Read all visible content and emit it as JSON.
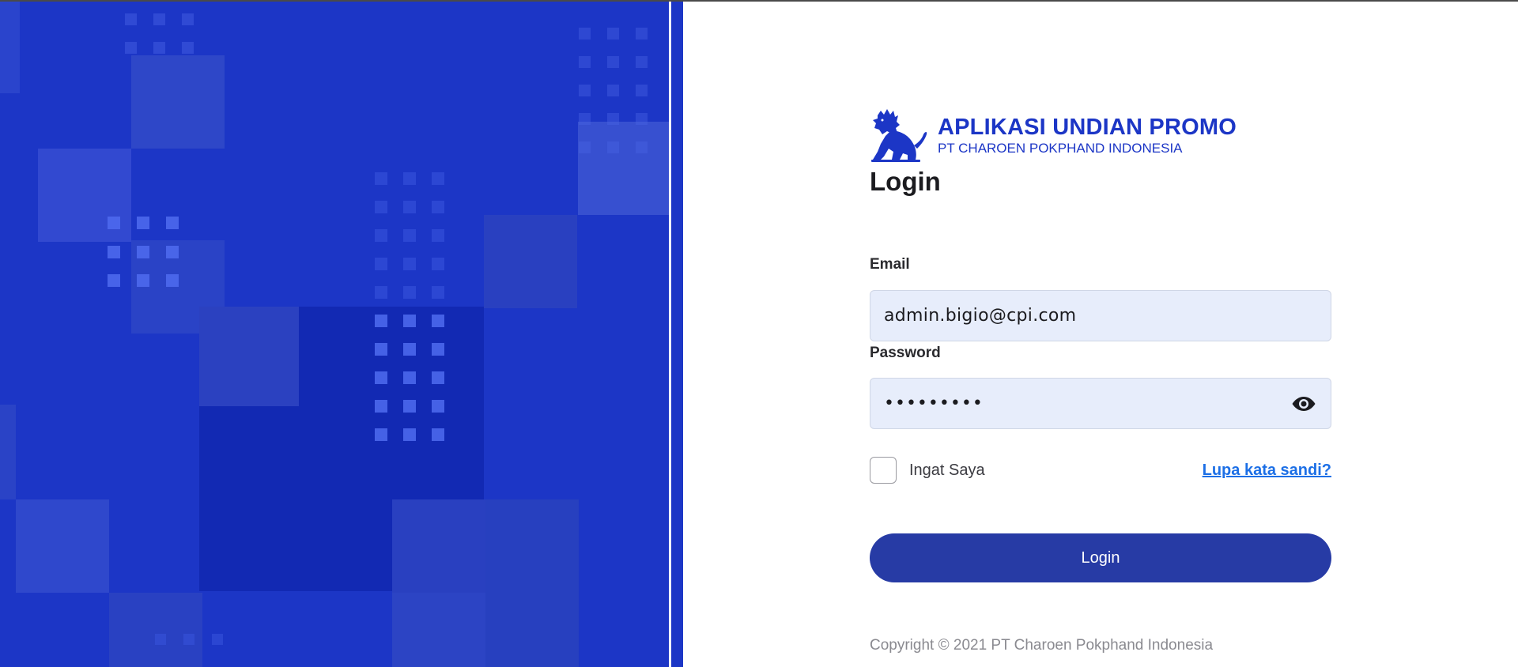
{
  "brand": {
    "title": "APLIKASI UNDIAN PROMO",
    "subtitle": "PT CHAROEN POKPHAND INDONESIA",
    "logo_icon": "lion-logo-icon",
    "color": "#1c36c6"
  },
  "login": {
    "heading": "Login",
    "email_label": "Email",
    "email_value": "admin.bigio@cpi.com",
    "password_label": "Password",
    "password_value": "•••••••••",
    "password_toggle_icon": "eye-icon",
    "remember_label": "Ingat Saya",
    "remember_checked": false,
    "forgot_link": "Lupa kata sandi?",
    "submit_label": "Login"
  },
  "footer": {
    "copyright": "Copyright © 2021 PT Charoen Pokphand Indonesia"
  },
  "colors": {
    "background_blue": "#1c36c6",
    "button_blue": "#273ba5",
    "link_blue": "#1c6fe6",
    "input_bg": "#e7edfb"
  }
}
